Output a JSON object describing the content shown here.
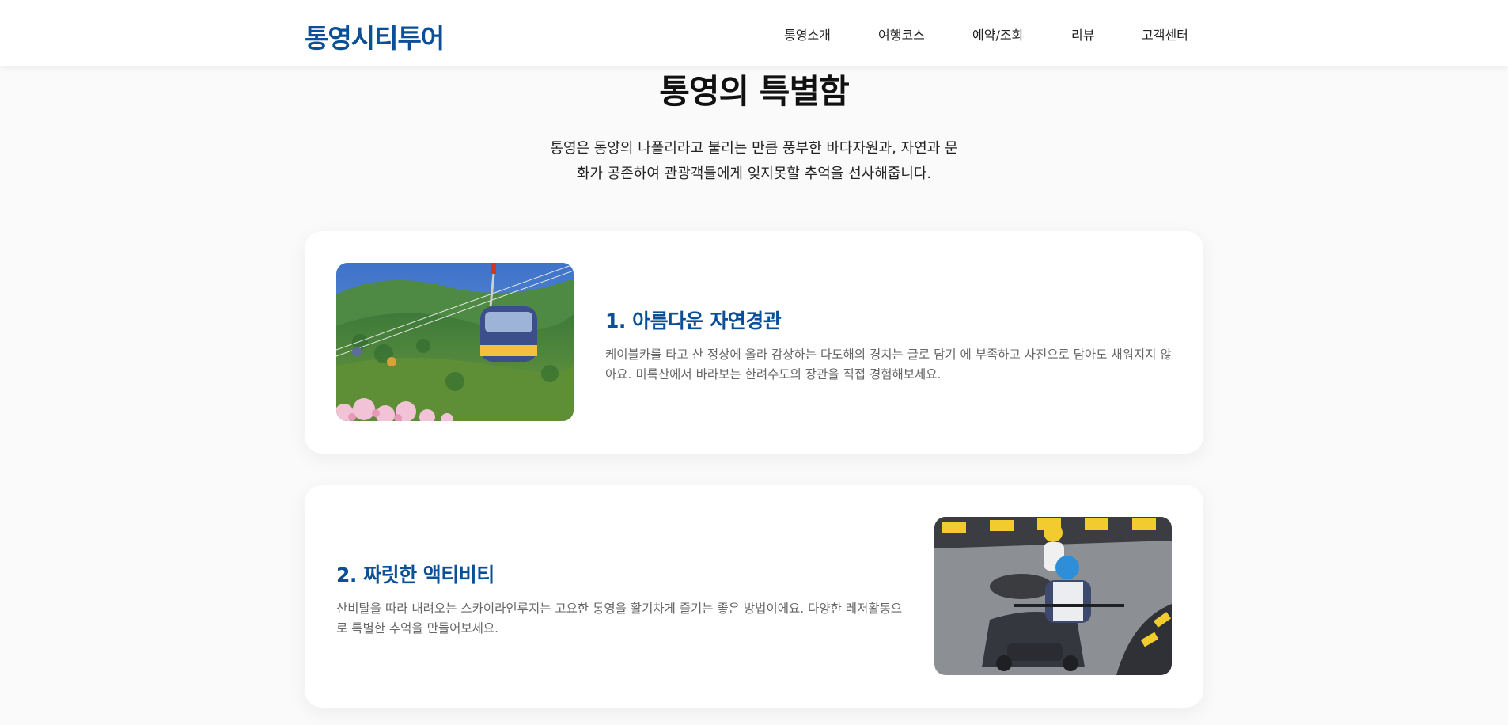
{
  "header": {
    "logo": "통영시티투어",
    "nav": [
      {
        "label": "통영소개"
      },
      {
        "label": "여행코스"
      },
      {
        "label": "예약/조회"
      },
      {
        "label": "리뷰"
      },
      {
        "label": "고객센터"
      }
    ]
  },
  "section": {
    "title": "통영의 특별함",
    "intro_line1": "통영은 동양의 나폴리라고 불리는 만큼 풍부한 바다자원과, 자연과 문",
    "intro_line2": "화가 공존하여 관광객들에게 잊지못할 추억을 선사해줍니다."
  },
  "features": [
    {
      "title": "1. 아름다운 자연경관",
      "description": "케이블카를 타고 산 정상에 올라 감상하는 다도해의 경치는 글로 담기 에 부족하고 사진으로 담아도 채워지지 않아요. 미륵산에서 바라보는 한려수도의 장관을 직접 경험해보세요.",
      "image": "cable-car-photo"
    },
    {
      "title": "2. 짜릿한 액티비티",
      "description": "산비탈을 따라 내려오는 스카이라인루지는 고요한 통영을 활기차게 즐기는 좋은 방법이에요. 다양한 레저활동으로 특별한 추억을 만들어보세요.",
      "image": "skyline-luge-photo"
    }
  ],
  "colors": {
    "brand": "#0b4f96",
    "background": "#fafafa",
    "card": "#ffffff",
    "body_text": "#666666"
  }
}
